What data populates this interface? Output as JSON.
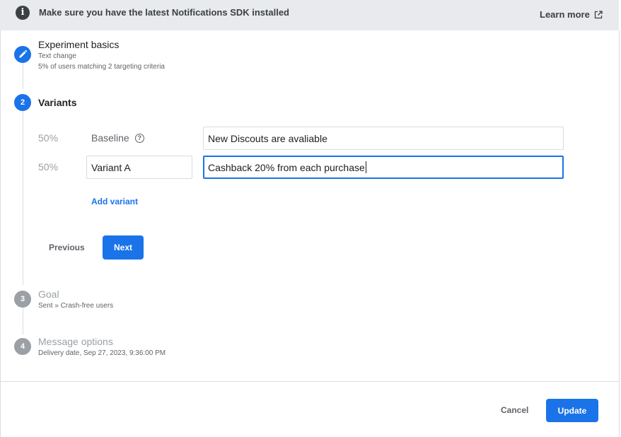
{
  "banner": {
    "icon": "info-icon",
    "message": "Make sure you have the latest Notifications SDK installed",
    "link_label": "Learn more",
    "link_icon": "open-in-new-icon"
  },
  "steps": [
    {
      "number": "",
      "icon": "edit-icon",
      "title": "Experiment basics",
      "subtitle_lines": [
        "Text change",
        "5% of users matching 2 targeting criteria"
      ]
    },
    {
      "number": "2",
      "title": "Variants"
    },
    {
      "number": "3",
      "title": "Goal",
      "subtitle": "Sent » Crash-free users"
    },
    {
      "number": "4",
      "title": "Message options",
      "subtitle": "Delivery date, Sep 27, 2023, 9:36:00 PM"
    }
  ],
  "variants": {
    "baseline": {
      "percent": "50%",
      "label": "Baseline",
      "help_icon": "help-icon",
      "value": "New Discouts are avaliable"
    },
    "variant_a": {
      "percent": "50%",
      "name": "Variant A",
      "value": "Cashback 20% from each purchase"
    },
    "add_variant_label": "Add variant",
    "previous_label": "Previous",
    "next_label": "Next"
  },
  "footer": {
    "cancel_label": "Cancel",
    "update_label": "Update"
  },
  "colors": {
    "accent": "#1a73e8",
    "banner_bg": "#e8eaed",
    "inactive_step": "#9aa0a6"
  }
}
